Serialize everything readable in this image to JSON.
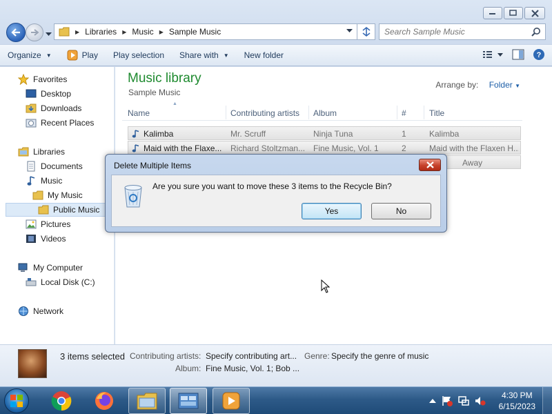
{
  "address": {
    "crumbs": [
      "Libraries",
      "Music",
      "Sample Music"
    ],
    "search_placeholder": "Search Sample Music"
  },
  "toolbar": {
    "organize": "Organize",
    "play": "Play",
    "play_selection": "Play selection",
    "share_with": "Share with",
    "new_folder": "New folder"
  },
  "nav": {
    "favorites": "Favorites",
    "desktop": "Desktop",
    "downloads": "Downloads",
    "recent_places": "Recent Places",
    "libraries": "Libraries",
    "documents": "Documents",
    "music": "Music",
    "my_music": "My Music",
    "public_music": "Public Music",
    "pictures": "Pictures",
    "videos": "Videos",
    "my_computer": "My Computer",
    "local_disk": "Local Disk (C:)",
    "network": "Network"
  },
  "content": {
    "title": "Music library",
    "subtitle": "Sample Music",
    "arrange_label": "Arrange by:",
    "arrange_value": "Folder",
    "columns": [
      "Name",
      "Contributing artists",
      "Album",
      "#",
      "Title"
    ],
    "rows": [
      {
        "name": "Kalimba",
        "artist": "Mr. Scruff",
        "album": "Ninja Tuna",
        "num": "1",
        "title": "Kalimba"
      },
      {
        "name": "Maid with the Flaxe...",
        "artist": "Richard Stoltzman...",
        "album": "Fine Music, Vol. 1",
        "num": "2",
        "title": "Maid with the Flaxen H..."
      },
      {
        "name": "",
        "artist": "",
        "album": "",
        "num": "",
        "title": "Away"
      }
    ]
  },
  "details": {
    "count": "3 items selected",
    "artists_label": "Contributing artists:",
    "artists_value": "Specify contributing art...",
    "genre_label": "Genre:",
    "genre_value": "Specify the genre of music",
    "album_label": "Album:",
    "album_value": "Fine Music, Vol. 1; Bob ..."
  },
  "dialog": {
    "title": "Delete Multiple Items",
    "message": "Are you sure you want to move these 3 items to the Recycle Bin?",
    "yes": "Yes",
    "no": "No"
  },
  "clock": {
    "time": "4:30 PM",
    "date": "6/15/2023"
  },
  "colors": {
    "library_title": "#1e8a2f",
    "taskbar": "#2d5a88",
    "dialog_frame": "#c7d8ee",
    "close_red": "#c6412b"
  }
}
